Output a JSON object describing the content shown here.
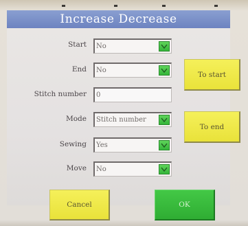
{
  "dialog": {
    "title": "Increase Decrease"
  },
  "fields": {
    "start": {
      "label": "Start",
      "value": "No"
    },
    "end": {
      "label": "End",
      "value": "No"
    },
    "stitch_number": {
      "label": "Stitch number",
      "value": "0"
    },
    "mode": {
      "label": "Mode",
      "value": "Stitch number"
    },
    "sewing": {
      "label": "Sewing",
      "value": "Yes"
    },
    "move": {
      "label": "Move",
      "value": "No"
    }
  },
  "buttons": {
    "to_start": "To start",
    "to_end": "To end",
    "cancel": "Cancel",
    "ok": "OK"
  },
  "colors": {
    "title_bar": "#7a8fc9",
    "yellow_button": "#eee84a",
    "green_button": "#38b93c",
    "dropdown_arrow": "#47c64a"
  },
  "icons": {
    "dropdown": "chevron-down-icon"
  }
}
